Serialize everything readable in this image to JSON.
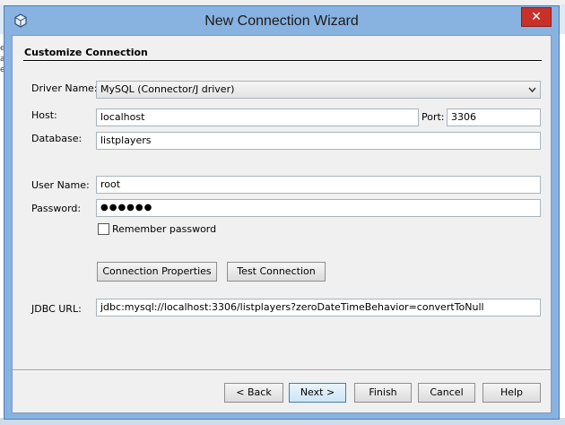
{
  "window": {
    "title": "New Connection Wizard",
    "close_glyph": "✕",
    "app_icon": "database-cube-icon"
  },
  "background": {
    "left_text": [
      "e",
      "ar",
      "e"
    ]
  },
  "section": {
    "title": "Customize Connection"
  },
  "form": {
    "driver_label": "Driver Name:",
    "driver_value": "MySQL (Connector/J driver)",
    "host_label": "Host:",
    "host_value": "localhost",
    "port_label": "Port:",
    "port_value": "3306",
    "database_label": "Database:",
    "database_value": "listplayers",
    "username_label": "User Name:",
    "username_value": "root",
    "password_label": "Password:",
    "password_value": "●●●●●●",
    "remember_label": "Remember password",
    "remember_checked": false,
    "jdbc_label": "JDBC URL:",
    "jdbc_value": "jdbc:mysql://localhost:3306/listplayers?zeroDateTimeBehavior=convertToNull"
  },
  "buttons": {
    "connection_properties": "Connection Properties",
    "test_connection": "Test Connection",
    "back": "< Back",
    "next": "Next >",
    "finish": "Finish",
    "cancel": "Cancel",
    "help": "Help"
  }
}
